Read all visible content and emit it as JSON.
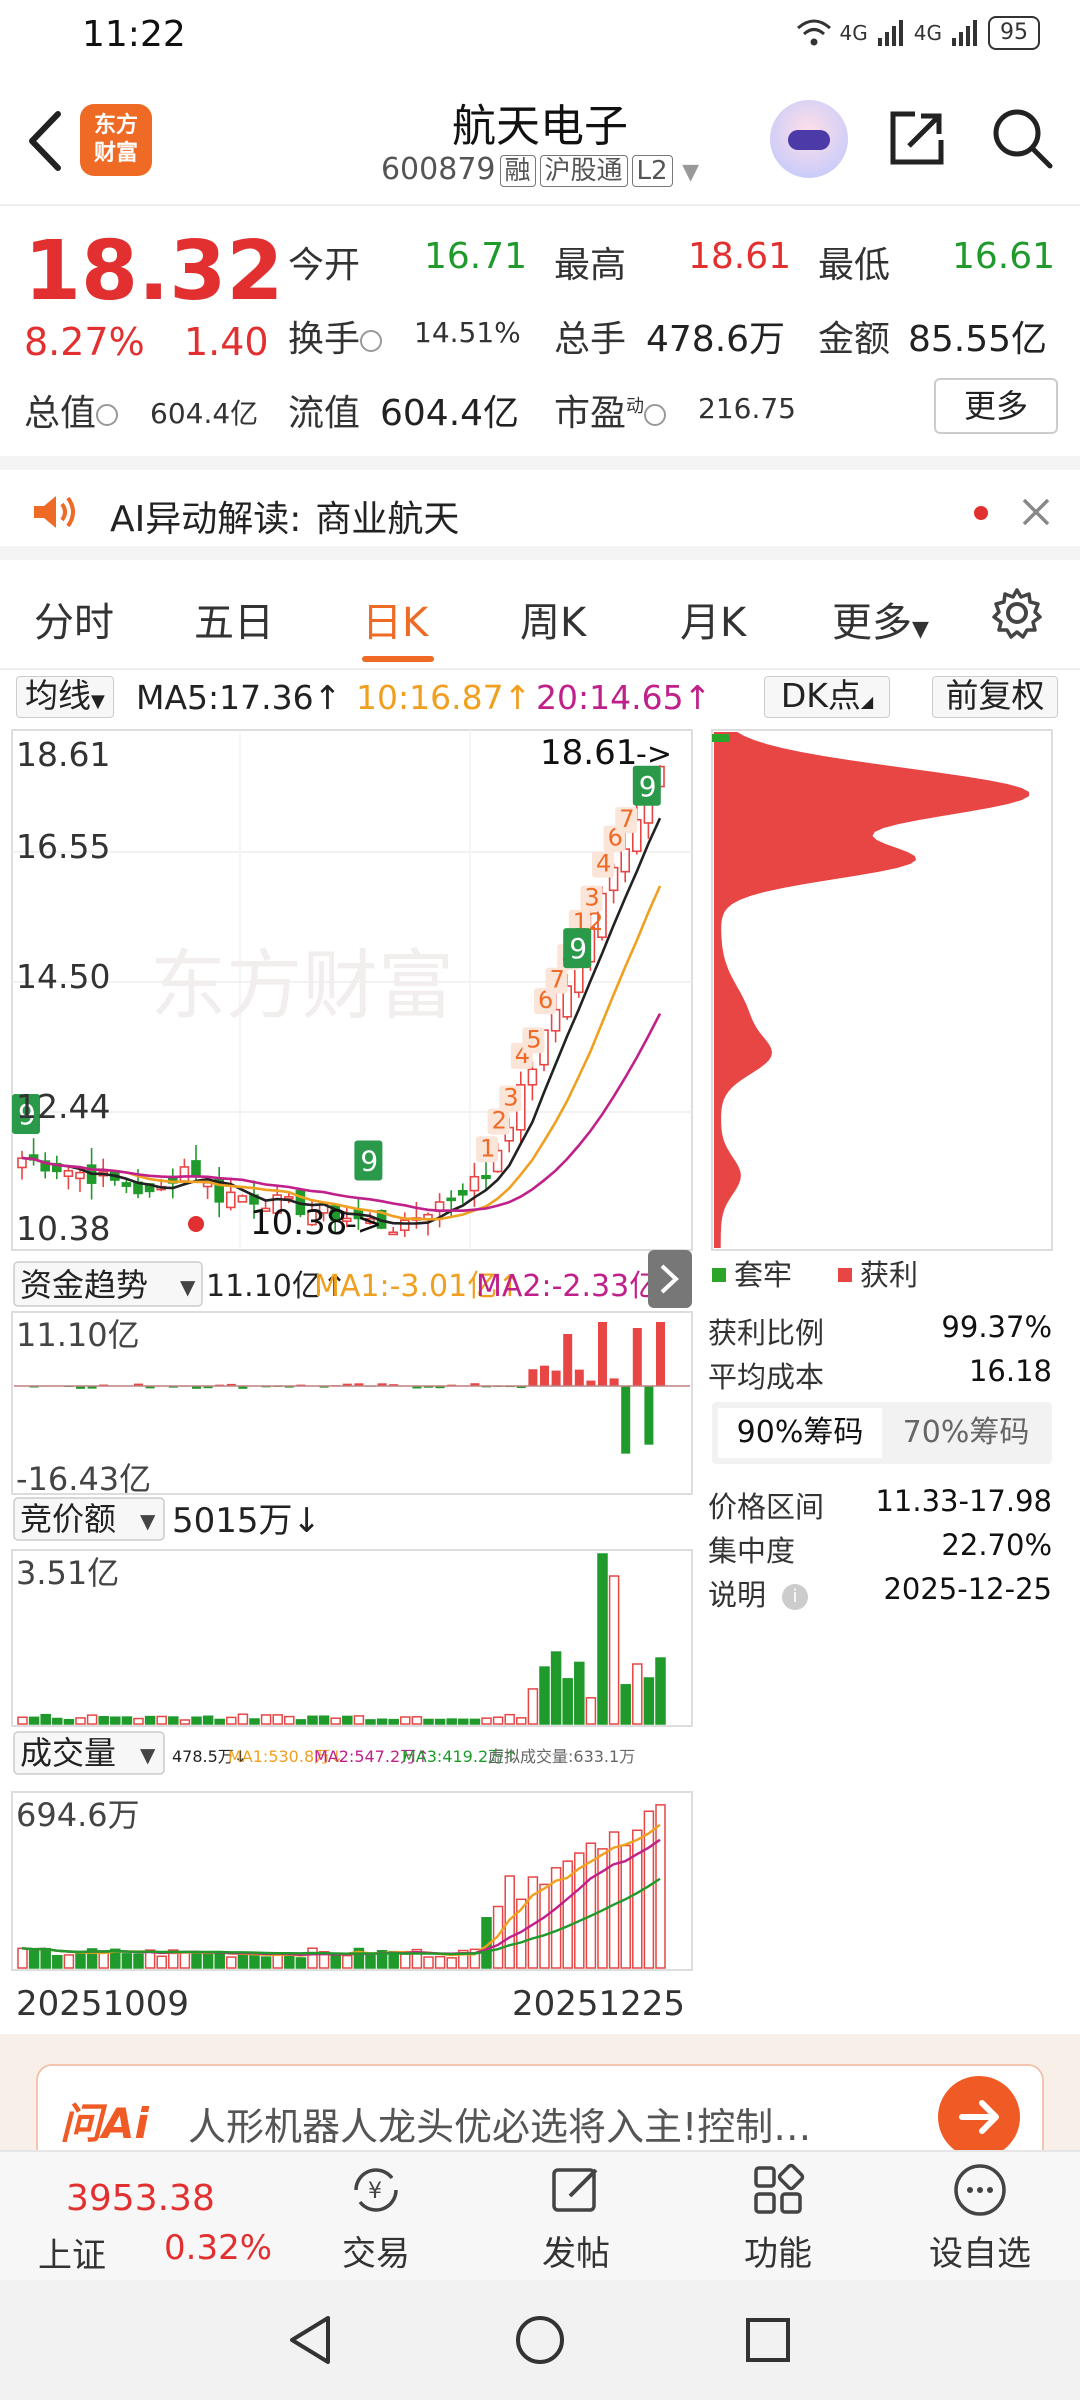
{
  "status": {
    "time": "11:22",
    "net1": "4G",
    "net2": "4G",
    "battery": "95"
  },
  "header": {
    "logo_line1": "东方",
    "logo_line2": "财富",
    "title": "航天电子",
    "code": "600879",
    "tags": [
      "融",
      "沪股通",
      "L2"
    ]
  },
  "quote": {
    "price": "18.32",
    "change_pct": "8.27%",
    "change_amt": "1.40",
    "open_label": "今开",
    "open": "16.71",
    "high_label": "最高",
    "high": "18.61",
    "low_label": "最低",
    "low": "16.61",
    "turnover_label": "换手",
    "turnover": "14.51%",
    "volume_label": "总手",
    "volume": "478.6万",
    "amount_label": "金额",
    "amount": "85.55亿",
    "mktcap_label": "总值",
    "mktcap": "604.4亿",
    "float_label": "流值",
    "float": "604.4亿",
    "pe_label": "市盈",
    "pe_sup": "动",
    "pe": "216.75",
    "more": "更多"
  },
  "ai_bar": {
    "label": "AI异动解读:",
    "topic": "商业航天"
  },
  "tabs": [
    "分时",
    "五日",
    "日K",
    "周K",
    "月K",
    "更多"
  ],
  "active_tab": "日K",
  "ma": {
    "selector": "均线",
    "ma5": "MA5:17.36↑",
    "ma10": "10:16.87↑",
    "ma20": "20:14.65↑",
    "dk": "DK点",
    "adjust": "前复权",
    "colors": {
      "ma5": "#222222",
      "ma10": "#f0a020",
      "ma20": "#c0208a"
    }
  },
  "kline": {
    "axis_labels": [
      "18.61",
      "16.55",
      "14.50",
      "12.44",
      "10.38"
    ],
    "high_marker": "18.61",
    "low_marker": "10.38",
    "watermark": "东方财富"
  },
  "capital": {
    "selector": "资金趋势",
    "value": "11.10亿↑",
    "ma1": "MA1:-3.01亿↑",
    "ma2": "MA2:-2.33亿↑",
    "top": "11.10亿",
    "bottom": "-16.43亿"
  },
  "auction": {
    "selector": "竞价额",
    "value": "5015万↓",
    "top": "3.51亿"
  },
  "volume": {
    "selector": "成交量",
    "value": "478.5万↓",
    "ma1": "MA1:530.8万↓",
    "ma2": "MA2:547.2万↑",
    "ma3": "MA3:419.2万↑",
    "virtual": "虚拟成交量:633.1万",
    "top": "694.6万"
  },
  "dates": {
    "start": "20251009",
    "end": "20251225"
  },
  "chips": {
    "legend_trapped": "套牢",
    "legend_profit": "获利",
    "profit_ratio_label": "获利比例",
    "profit_ratio": "99.37%",
    "avg_cost_label": "平均成本",
    "avg_cost": "16.18",
    "tab90": "90%筹码",
    "tab70": "70%筹码",
    "range_label": "价格区间",
    "range": "11.33-17.98",
    "concentration_label": "集中度",
    "concentration": "22.70%",
    "note_label": "说明",
    "note_date": "2025-12-25",
    "colors": {
      "profit": "#e84545",
      "trapped": "#2aa52a"
    }
  },
  "ad": {
    "logo": "问Ai",
    "text": "人形机器人龙头优必选将入主!控制…"
  },
  "bottom_nav": {
    "index_value": "3953.38",
    "index_name": "上证",
    "index_pct": "0.32%",
    "items": [
      "交易",
      "发帖",
      "功能",
      "设自选"
    ]
  }
}
